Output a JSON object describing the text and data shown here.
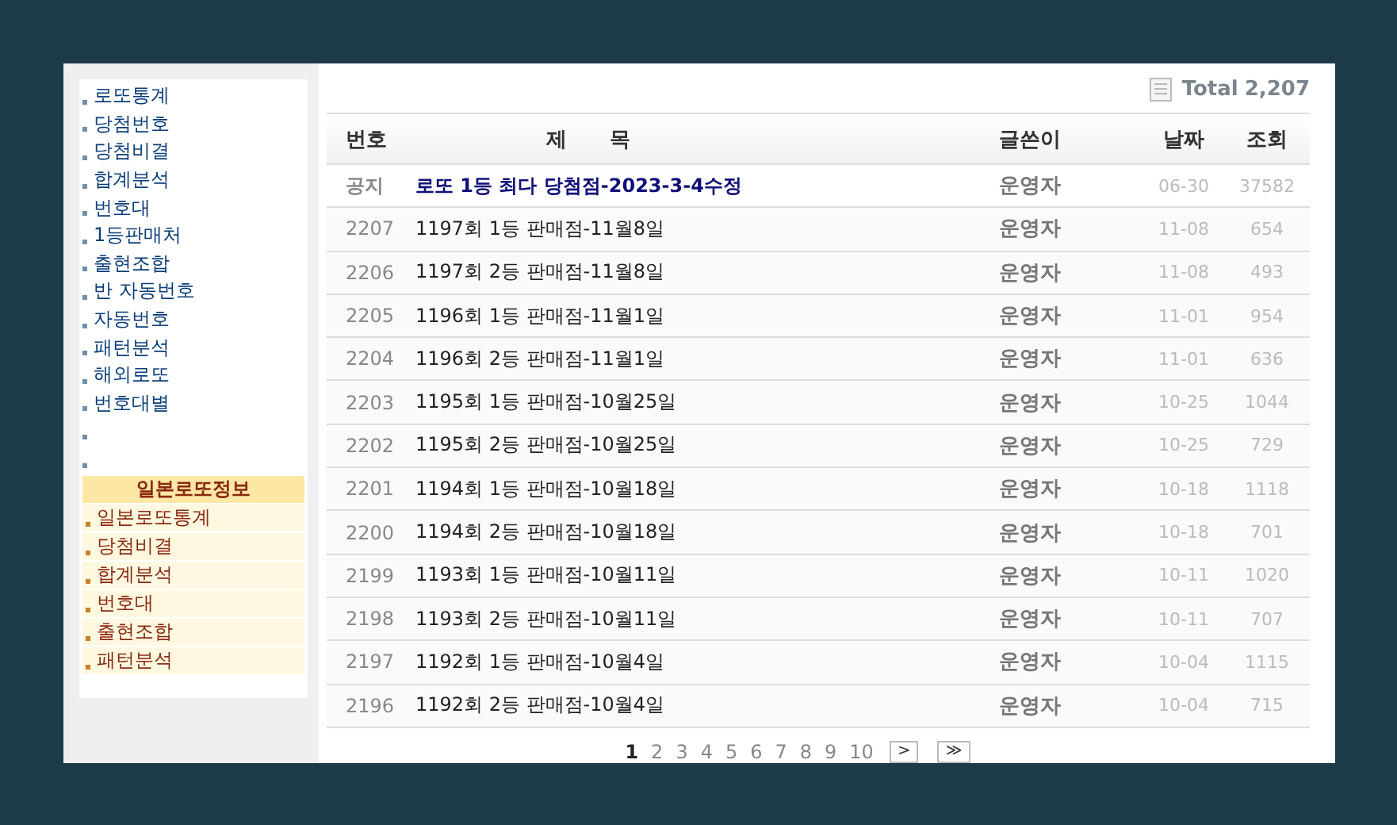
{
  "sidebar": {
    "items": [
      {
        "kind": "link",
        "label": "로또통계"
      },
      {
        "kind": "link",
        "label": "당첨번호"
      },
      {
        "kind": "link",
        "label": "당첨비결"
      },
      {
        "kind": "link",
        "label": "합계분석"
      },
      {
        "kind": "link",
        "label": "번호대"
      },
      {
        "kind": "link",
        "label": "1등판매처"
      },
      {
        "kind": "link",
        "label": "출현조합"
      },
      {
        "kind": "link",
        "label": "반 자동번호"
      },
      {
        "kind": "link",
        "label": "자동번호"
      },
      {
        "kind": "link",
        "label": "패턴분석"
      },
      {
        "kind": "link",
        "label": "해외로또"
      },
      {
        "kind": "link",
        "label": "번호대별"
      },
      {
        "kind": "blank"
      },
      {
        "kind": "blank"
      }
    ],
    "section_title": "일본로또정보",
    "section_items": [
      "일본로또통계",
      "당첨비결",
      "합계분석",
      "번호대",
      "출현조합",
      "패턴분석"
    ]
  },
  "board": {
    "total_label": "Total",
    "total": "2,207",
    "columns": [
      "번호",
      "제      목",
      "글쓴이",
      "날짜",
      "조회"
    ],
    "rows": [
      {
        "kind": "notice",
        "no": "공지",
        "title": "로또 1등 최다 당첨점-2023-3-4수정",
        "author": "운영자",
        "date": "06-30",
        "views": "37582"
      },
      {
        "kind": "post",
        "no": "2207",
        "title": "1197회 1등 판매점-11월8일",
        "author": "운영자",
        "date": "11-08",
        "views": "654"
      },
      {
        "kind": "post",
        "no": "2206",
        "title": "1197회 2등 판매점-11월8일",
        "author": "운영자",
        "date": "11-08",
        "views": "493"
      },
      {
        "kind": "post",
        "no": "2205",
        "title": "1196회 1등 판매점-11월1일",
        "author": "운영자",
        "date": "11-01",
        "views": "954"
      },
      {
        "kind": "post",
        "no": "2204",
        "title": "1196회 2등 판매점-11월1일",
        "author": "운영자",
        "date": "11-01",
        "views": "636"
      },
      {
        "kind": "post",
        "no": "2203",
        "title": "1195회 1등 판매점-10월25일",
        "author": "운영자",
        "date": "10-25",
        "views": "1044"
      },
      {
        "kind": "post",
        "no": "2202",
        "title": "1195회 2등 판매점-10월25일",
        "author": "운영자",
        "date": "10-25",
        "views": "729"
      },
      {
        "kind": "post",
        "no": "2201",
        "title": "1194회 1등 판매점-10월18일",
        "author": "운영자",
        "date": "10-18",
        "views": "1118"
      },
      {
        "kind": "post",
        "no": "2200",
        "title": "1194회 2등 판매점-10월18일",
        "author": "운영자",
        "date": "10-18",
        "views": "701"
      },
      {
        "kind": "post",
        "no": "2199",
        "title": "1193회 1등 판매점-10월11일",
        "author": "운영자",
        "date": "10-11",
        "views": "1020"
      },
      {
        "kind": "post",
        "no": "2198",
        "title": "1193회 2등 판매점-10월11일",
        "author": "운영자",
        "date": "10-11",
        "views": "707"
      },
      {
        "kind": "post",
        "no": "2197",
        "title": "1192회 1등 판매점-10월4일",
        "author": "운영자",
        "date": "10-04",
        "views": "1115"
      },
      {
        "kind": "post",
        "no": "2196",
        "title": "1192회 2등 판매점-10월4일",
        "author": "운영자",
        "date": "10-04",
        "views": "715"
      }
    ],
    "pagination": {
      "pages": [
        {
          "label": "1",
          "selected": true
        },
        {
          "label": "2",
          "selected": false
        },
        {
          "label": "3",
          "selected": false
        },
        {
          "label": "4",
          "selected": false
        },
        {
          "label": "5",
          "selected": false
        },
        {
          "label": "6",
          "selected": false
        },
        {
          "label": "7",
          "selected": false
        },
        {
          "label": "8",
          "selected": false
        },
        {
          "label": "9",
          "selected": false
        },
        {
          "label": "10",
          "selected": false
        }
      ],
      "next": ">",
      "last": "≫"
    }
  }
}
